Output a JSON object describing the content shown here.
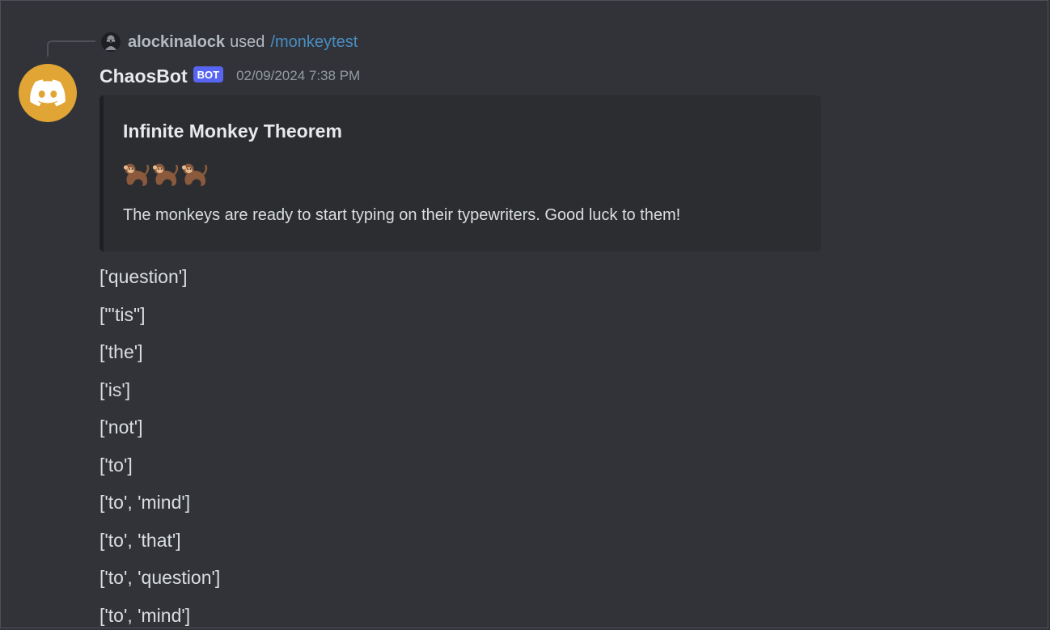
{
  "reply": {
    "username": "alockinalock",
    "used": "used",
    "command": "/monkeytest"
  },
  "message": {
    "username": "ChaosBot",
    "badge": "BOT",
    "timestamp": "02/09/2024 7:38 PM"
  },
  "embed": {
    "title": "Infinite Monkey Theorem",
    "emoji": [
      "monkey",
      "monkey",
      "monkey"
    ],
    "description": "The monkeys are ready to start typing on their typewriters. Good luck to them!"
  },
  "lines": [
    "['question']",
    "[\"'tis\"]",
    "['the']",
    "['is']",
    "['not']",
    "['to']",
    "['to', 'mind']",
    "['to', 'that']",
    "['to', 'question']",
    "['to', 'mind']"
  ],
  "colors": {
    "background": "#313338",
    "embed_bg": "#2b2d31",
    "avatar_bg": "#e0a534",
    "badge_bg": "#5865f2",
    "command_link": "#4a8ec2",
    "timestamp": "#949ba4"
  }
}
